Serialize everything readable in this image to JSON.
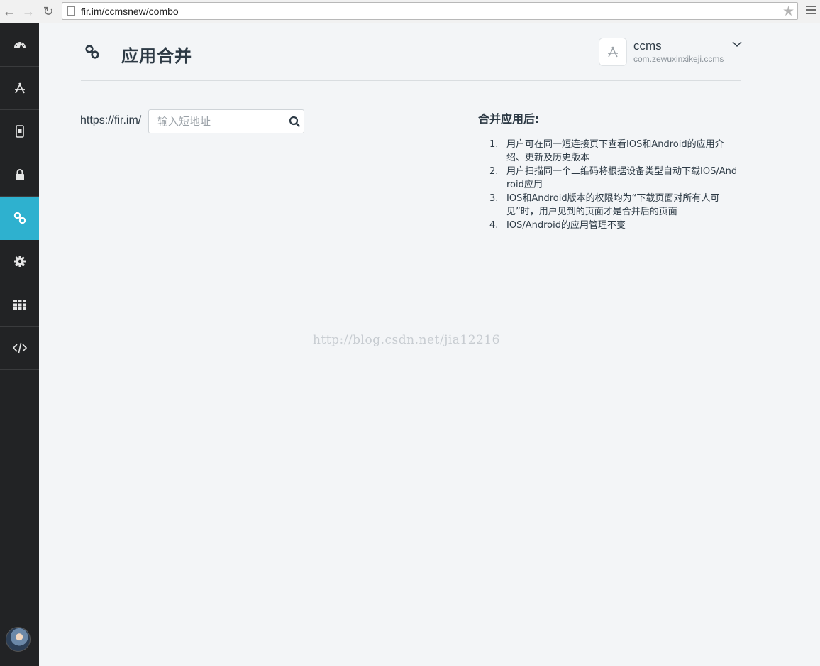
{
  "browser": {
    "url": "fir.im/ccmsnew/combo",
    "back_glyph": "←",
    "forward_glyph": "→",
    "reload_glyph": "↻",
    "star_glyph": "★"
  },
  "sidebar": {
    "items": [
      {
        "icon": "dashboard-icon"
      },
      {
        "icon": "app-store-icon"
      },
      {
        "icon": "device-id-icon"
      },
      {
        "icon": "lock-icon"
      },
      {
        "icon": "link-icon",
        "active": true
      },
      {
        "icon": "gear-icon"
      },
      {
        "icon": "grid-icon"
      },
      {
        "icon": "code-icon"
      }
    ],
    "active_color": "#2eb1cf"
  },
  "header": {
    "title": "应用合并",
    "icon": "link-icon"
  },
  "app": {
    "name": "ccms",
    "bundle_id": "com.zewuxinxikeji.ccms"
  },
  "combo": {
    "prefix": "https://fir.im/",
    "input_placeholder": "输入短地址",
    "input_value": ""
  },
  "info": {
    "title": "合并应用后:",
    "items": [
      {
        "num": "1.",
        "text": "用户可在同一短连接页下查看IOS和Android的应用介绍、更新及历史版本"
      },
      {
        "num": "2.",
        "text": "用户扫描同一个二维码将根据设备类型自动下载IOS/Android应用"
      },
      {
        "num": "3.",
        "text": "IOS和Android版本的权限均为“下载页面对所有人可见”时，用户见到的页面才是合并后的页面"
      },
      {
        "num": "4.",
        "text": "IOS/Android的应用管理不变"
      }
    ]
  },
  "watermark": "http://blog.csdn.net/jia12216"
}
